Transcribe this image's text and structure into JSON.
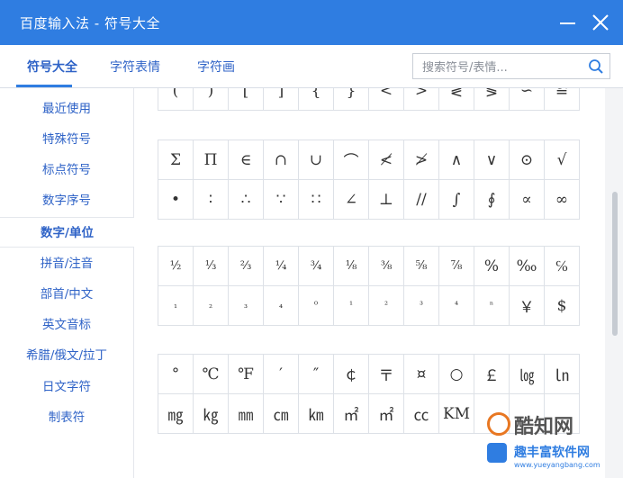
{
  "window": {
    "title": "百度输入法 - 符号大全"
  },
  "tabs": [
    {
      "label": "符号大全",
      "active": true
    },
    {
      "label": "字符表情",
      "active": false
    },
    {
      "label": "字符画",
      "active": false
    }
  ],
  "search": {
    "placeholder": "搜索符号/表情..."
  },
  "sidebar": {
    "items": [
      {
        "label": "最近使用"
      },
      {
        "label": "特殊符号"
      },
      {
        "label": "标点符号"
      },
      {
        "label": "数字序号"
      },
      {
        "label": "数字/单位",
        "active": true
      },
      {
        "label": "拼音/注音"
      },
      {
        "label": "部首/中文"
      },
      {
        "label": "英文音标"
      },
      {
        "label": "希腊/俄文/拉丁"
      },
      {
        "label": "日文字符"
      },
      {
        "label": "制表符"
      }
    ]
  },
  "symbols": {
    "group0_row0": [
      "(",
      ")",
      "[",
      "]",
      "{",
      "}",
      "<",
      ">",
      "≷",
      "≶",
      "∽",
      "≌"
    ],
    "group1_row0": [
      "Σ",
      "Π",
      "∈",
      "∩",
      "∪",
      "⌒",
      "≮",
      "≯",
      "∧",
      "∨",
      "⊙",
      "√"
    ],
    "group1_row1": [
      "•",
      "∶",
      "∴",
      "∵",
      "∷",
      "∠",
      "⊥",
      "//",
      "∫",
      "∮",
      "∝",
      "∞"
    ],
    "group2_row0": [
      "½",
      "⅓",
      "⅔",
      "¼",
      "¾",
      "⅛",
      "⅜",
      "⅝",
      "⅞",
      "%",
      "‰",
      "℅"
    ],
    "group2_row1": [
      "₁",
      "₂",
      "₃",
      "₄",
      "⁰",
      "¹",
      "²",
      "³",
      "⁴",
      "ⁿ",
      "￥",
      "$"
    ],
    "group3_row0": [
      "°",
      "℃",
      "℉",
      "′",
      "″",
      "￠",
      "〒",
      "¤",
      "○",
      "￡",
      "㏒",
      "㏑"
    ],
    "group3_row1": [
      "㎎",
      "㎏",
      "㎜",
      "㎝",
      "㎞",
      "㎡",
      "㎡",
      "㏄",
      "KM",
      "",
      "",
      ""
    ]
  },
  "watermark": {
    "brand": "酷知网",
    "sub": "趣丰富软件网",
    "url": "www.yueyangbang.com"
  }
}
